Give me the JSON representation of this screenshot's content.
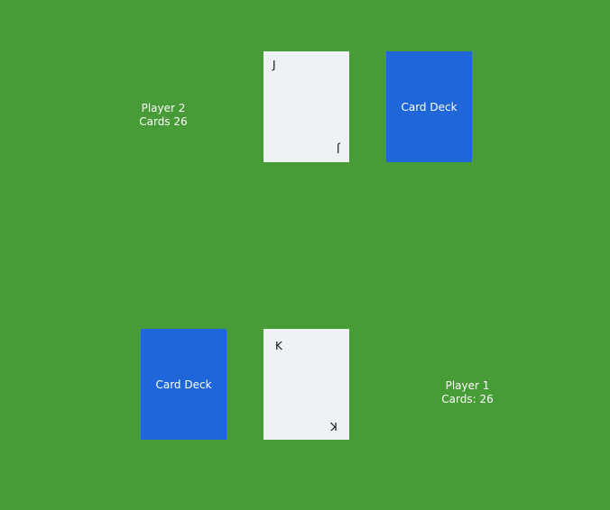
{
  "player2": {
    "name": "Player 2",
    "cards": "Cards 26",
    "played_card": {
      "rank": "J"
    },
    "deck_label": "Card Deck"
  },
  "player1": {
    "name": "Player 1",
    "cards": "Cards: 26",
    "played_card": {
      "rank": "K"
    },
    "deck_label": "Card Deck"
  },
  "colors": {
    "table": "#479c37",
    "card_face": "#eef2f5",
    "deck_back": "#1f66d9"
  }
}
